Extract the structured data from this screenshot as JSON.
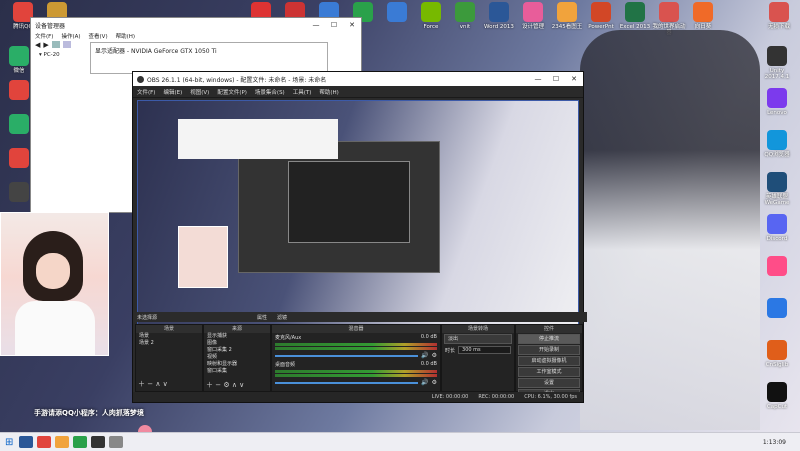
{
  "desktop_icons_top": [
    {
      "label": "腾讯QQ",
      "color": "#e1443c"
    },
    {
      "label": "",
      "color": "#c93"
    },
    {
      "label": "",
      "color": "#d33"
    },
    {
      "label": "",
      "color": "#c33"
    },
    {
      "label": "",
      "color": "#3a7bd5"
    },
    {
      "label": "",
      "color": "#2aa14a"
    },
    {
      "label": "",
      "color": "#3a7bd5"
    },
    {
      "label": "Force",
      "color": "#77b900"
    },
    {
      "label": "vnit",
      "color": "#3c9a3c"
    },
    {
      "label": "Word 2013",
      "color": "#2b5797"
    },
    {
      "label": "设计管理",
      "color": "#e85d9a"
    },
    {
      "label": "2345看图王",
      "color": "#f1a33c"
    },
    {
      "label": "PowerPnt",
      "color": "#d24726"
    },
    {
      "label": "Excel 2013",
      "color": "#217346"
    },
    {
      "label": "我的世界启动器",
      "color": "#d9534f"
    },
    {
      "label": "向日葵",
      "color": "#f06a28"
    },
    {
      "label": "无损下载",
      "color": "#d9534f"
    }
  ],
  "desktop_icons_right": [
    {
      "label": "Unity 2017.4.1",
      "color": "#333"
    },
    {
      "label": "Lenovo",
      "color": "#7c3aed"
    },
    {
      "label": "QQ浏览器",
      "color": "#1296db"
    },
    {
      "label": "英雄联盟WeGame",
      "color": "#1f4e79"
    },
    {
      "label": "Discord",
      "color": "#5865f2"
    },
    {
      "label": "",
      "color": "#ff4d88"
    },
    {
      "label": "",
      "color": "#2b78e4"
    },
    {
      "label": "CnSiglib",
      "color": "#e05e1a"
    },
    {
      "label": "CapCut",
      "color": "#111"
    }
  ],
  "desktop_icons_left": [
    {
      "label": "微信",
      "color": "#2aae67"
    },
    {
      "label": "",
      "color": "#e1443c"
    },
    {
      "label": "",
      "color": "#2aae67"
    },
    {
      "label": "",
      "color": "#e1443c"
    },
    {
      "label": "",
      "color": "#444"
    }
  ],
  "device_manager": {
    "title": "设备管理器",
    "menu": [
      "文件(F)",
      "操作(A)",
      "查看(V)",
      "帮助(H)"
    ],
    "node": "PC-20",
    "gpu_label": "显示适配器 - NVIDIA GeForce GTX 1050 Ti"
  },
  "obs": {
    "title": "OBS 26.1.1 (64-bit, windows) - 配置文件: 未命名 - 场景: 未命名",
    "menu": [
      "文件(F)",
      "编辑(E)",
      "视图(V)",
      "配置文件(P)",
      "场景集合(S)",
      "工具(T)",
      "帮助(H)"
    ],
    "source_none": "未选择源",
    "props_label": "属性",
    "filters_label": "滤镜",
    "panels": {
      "scenes": {
        "header": "场景",
        "items": [
          "场景",
          "场景 2"
        ]
      },
      "sources": {
        "header": "来源",
        "items": [
          "显示捕获",
          "图像",
          "窗口采集 2",
          "视频",
          "映射和显示器",
          "窗口采集"
        ]
      },
      "mixer": {
        "header": "混音器",
        "channels": [
          {
            "name": "麦克风/Aux",
            "db": "0.0 dB"
          },
          {
            "name": "桌面音频",
            "db": "0.0 dB"
          }
        ]
      },
      "transitions": {
        "header": "场景转场",
        "type": "淡出",
        "duration_label": "时长",
        "duration": "300 ms"
      },
      "controls": {
        "header": "控件",
        "buttons": [
          "停止推流",
          "开始录制",
          "启动虚拟摄像机",
          "工作室模式",
          "设置",
          "退出"
        ]
      }
    },
    "status": {
      "live": "LIVE: 00:00:00",
      "rec": "REC: 00:00:00",
      "cpu": "CPU: 6.1%, 30.00 fps"
    }
  },
  "overlay_text": "手游请添QQ小程序：人肉抓落梦境",
  "taskbar": {
    "time": "1:13:09",
    "date": ""
  }
}
